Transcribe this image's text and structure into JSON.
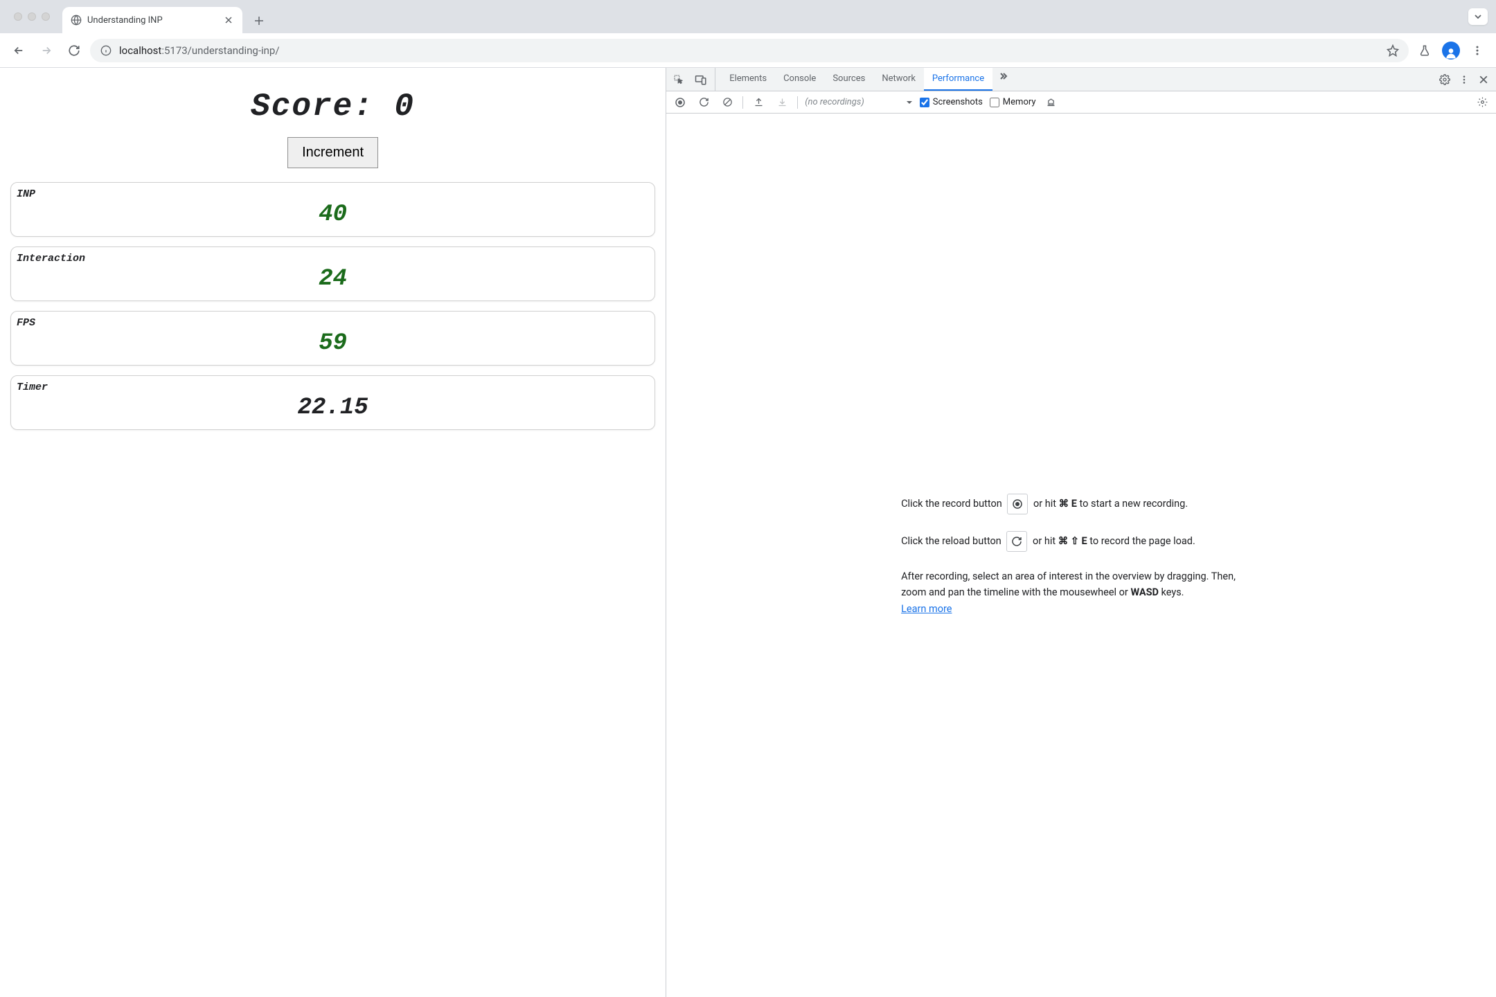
{
  "browser": {
    "tab_title": "Understanding INP",
    "url_host": "localhost",
    "url_port_path": ":5173/understanding-inp/"
  },
  "page": {
    "score_label": "Score:",
    "score_value": "0",
    "increment_label": "Increment",
    "metrics": [
      {
        "label": "INP",
        "value": "40",
        "color": "green"
      },
      {
        "label": "Interaction",
        "value": "24",
        "color": "green"
      },
      {
        "label": "FPS",
        "value": "59",
        "color": "green"
      },
      {
        "label": "Timer",
        "value": "22.15",
        "color": "black"
      }
    ]
  },
  "devtools": {
    "tabs": [
      "Elements",
      "Console",
      "Sources",
      "Network",
      "Performance"
    ],
    "active_tab": "Performance",
    "recordings_placeholder": "(no recordings)",
    "screenshots_label": "Screenshots",
    "screenshots_checked": true,
    "memory_label": "Memory",
    "memory_checked": false,
    "instructions": {
      "record_prefix": "Click the record button",
      "record_suffix_1": "or hit ",
      "record_key": "⌘ E",
      "record_suffix_2": " to start a new recording.",
      "reload_prefix": "Click the reload button",
      "reload_suffix_1": "or hit ",
      "reload_key": "⌘ ⇧ E",
      "reload_suffix_2": " to record the page load.",
      "after_1": "After recording, select an area of interest in the overview by dragging. Then, zoom and pan the timeline with the mousewheel or ",
      "after_key": "WASD",
      "after_2": " keys.",
      "learn_more": "Learn more"
    }
  }
}
